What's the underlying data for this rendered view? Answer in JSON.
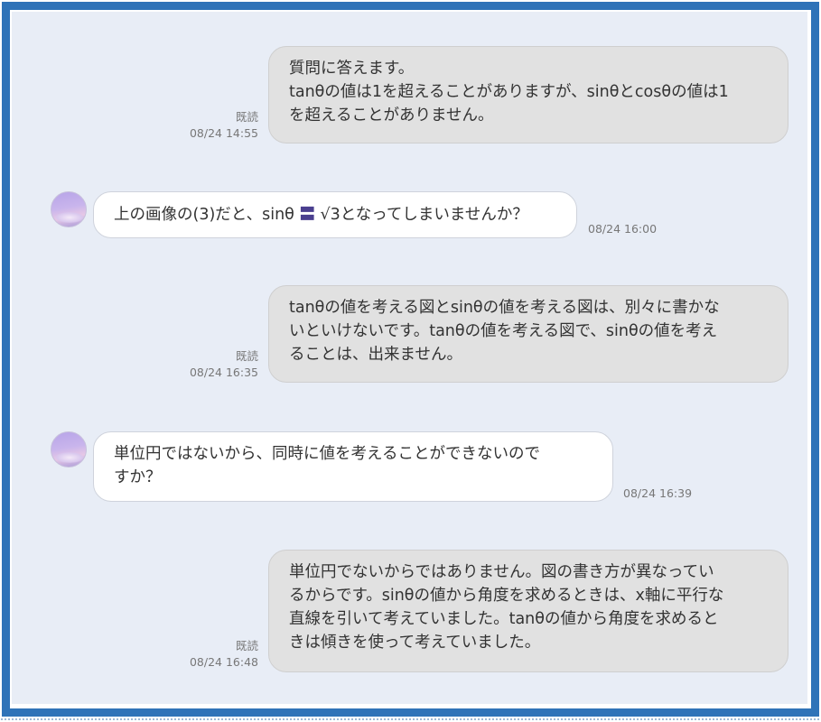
{
  "messages": [
    {
      "side": "me",
      "text": "質問に答えます。\ntanθの値は1を超えることがありますが、sinθとcosθの値は1を超えることがありません。",
      "line1": "質問に答えます。",
      "line2": "tanθの値は1を超えることがありますが、sinθとcosθの値は1",
      "line3": "を超えることがありません。",
      "read": "既読",
      "time": "08/24 14:55"
    },
    {
      "side": "them",
      "text_before": "上の画像の(3)だと、sinθ ",
      "text_symbol": "〓",
      "text_after": " √3となってしまいませんか？",
      "time": "08/24 16:00"
    },
    {
      "side": "me",
      "line1": "tanθの値を考える図とsinθの値を考える図は、別々に書かな",
      "line2": "いといけないです。tanθの値を考える図で、sinθの値を考え",
      "line3": "ることは、出来ません。",
      "read": "既読",
      "time": "08/24 16:35"
    },
    {
      "side": "them",
      "line1": "単位円ではないから、同時に値を考えることができないので",
      "line2": "すか？",
      "time": "08/24 16:39"
    },
    {
      "side": "me",
      "line1": "単位円でないからではありません。図の書き方が異なってい",
      "line2": "るからです。sinθの値から角度を求めるときは、x軸に平行な",
      "line3": "直線を引いて考えていました。tanθの値から角度を求めると",
      "line4": "きは傾きを使って考えていました。",
      "read": "既読",
      "time": "08/24 16:48"
    }
  ],
  "colors": {
    "frame": "#2f73b8",
    "chat_bg": "#e8edf6",
    "my_bubble": "#e1e1e1",
    "their_bubble": "#ffffff"
  }
}
